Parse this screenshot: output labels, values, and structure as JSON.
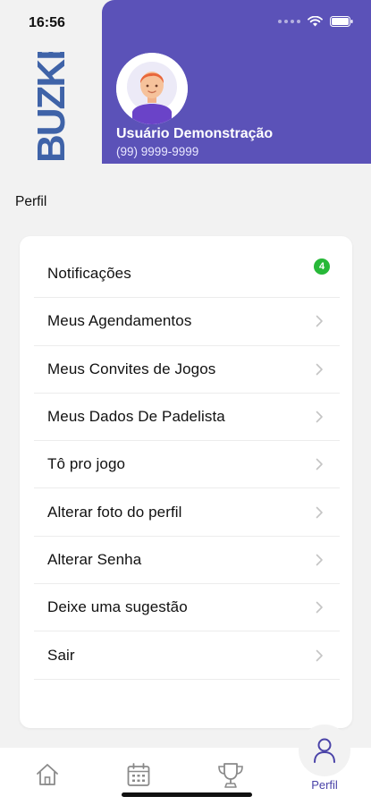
{
  "status": {
    "time": "16:56"
  },
  "brand": {
    "logo_text": "BUZKE",
    "accent_color": "#5b52b8"
  },
  "user": {
    "name": "Usuário Demonstração",
    "phone": "(99) 9999-9999"
  },
  "section_title": "Perfil",
  "menu": [
    {
      "label": "Notificações",
      "badge": "4"
    },
    {
      "label": "Meus Agendamentos"
    },
    {
      "label": "Meus Convites de Jogos"
    },
    {
      "label": "Meus Dados De Padelista"
    },
    {
      "label": "Tô pro jogo"
    },
    {
      "label": "Alterar foto do perfil"
    },
    {
      "label": "Alterar Senha"
    },
    {
      "label": "Deixe uma sugestão"
    },
    {
      "label": "Sair"
    }
  ],
  "tabs": [
    {
      "icon": "home-icon"
    },
    {
      "icon": "calendar-icon"
    },
    {
      "icon": "trophy-icon"
    },
    {
      "icon": "user-icon",
      "label": "Perfil",
      "active": true
    }
  ]
}
